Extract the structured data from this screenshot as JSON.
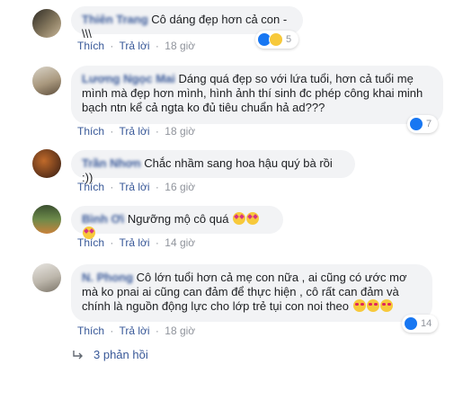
{
  "common": {
    "like_label": "Thích",
    "reply_label": "Trả lời",
    "separator": "·"
  },
  "comments": [
    {
      "author": "Thiên Trang",
      "text": "Cô dáng đẹp hơn cả con -\\\\\\",
      "time": "18 giờ",
      "reactions": [
        "like",
        "haha"
      ],
      "reaction_count": "5"
    },
    {
      "author": "Lương Ngọc Mai",
      "text": "Dáng quá đẹp so với lứa tuổi, hơn cả tuổi mẹ mình mà đẹp hơn mình, hình ảnh thí sinh đc phép công khai minh bạch ntn kể cả ngta ko đủ tiêu chuẩn hả ad???",
      "time": "18 giờ",
      "reactions": [
        "like"
      ],
      "reaction_count": "7"
    },
    {
      "author": "Trần Nhơn",
      "text": "Chắc nhầm sang hoa hậu quý bà rồi :))",
      "time": "16 giờ"
    },
    {
      "author": "Bình Ơi",
      "text": "Ngưỡng mộ cô quá",
      "emojis": [
        "star-struck",
        "star-struck",
        "star-struck"
      ],
      "time": "14 giờ"
    },
    {
      "author": "N. Phong",
      "text": "Cô lớn tuổi hơn cả mẹ con nữa , ai cũng có ước mơ mà ko pnai ai cũng can đảm để thực hiện , cô rất can đảm và chính là nguồn động lực cho lớp trẻ tụi con noi theo",
      "emojis": [
        "heart-eyes",
        "heart-eyes",
        "heart-eyes"
      ],
      "time": "18 giờ",
      "reactions": [
        "like"
      ],
      "reaction_count": "14"
    }
  ],
  "replies": {
    "label": "3 phản hồi",
    "icon": "reply-arrow-icon"
  },
  "colors": {
    "link": "#385898",
    "meta": "#90949c",
    "bubble": "#f2f3f5",
    "like": "#1877f2"
  }
}
